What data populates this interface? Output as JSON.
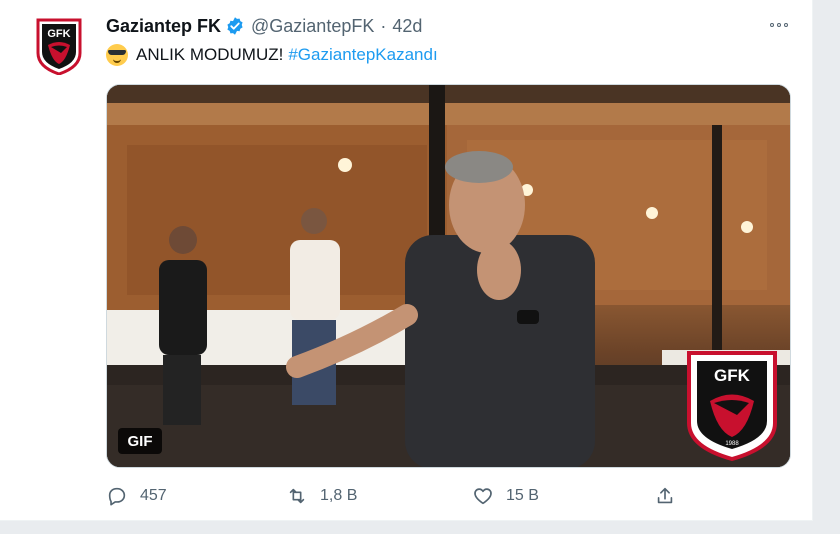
{
  "tweet": {
    "display_name": "Gaziantep FK",
    "handle": "@GaziantepFK",
    "separator": "·",
    "time": "42d",
    "text": "ANLIK MODUMUZ!",
    "hashtag": "#GaziantepKazandı",
    "emoji": "smiling-face-with-sunglasses"
  },
  "logo": {
    "text": "GFK",
    "year": "1988",
    "colors": {
      "red": "#c8102e",
      "black": "#111111",
      "white": "#ffffff"
    }
  },
  "media": {
    "badge": "GIF"
  },
  "actions": {
    "reply_count": "457",
    "retweet_count": "1,8 B",
    "like_count": "15 B"
  },
  "colors": {
    "link": "#1d9bf0",
    "muted": "#536471",
    "verified": "#1d9bf0"
  }
}
